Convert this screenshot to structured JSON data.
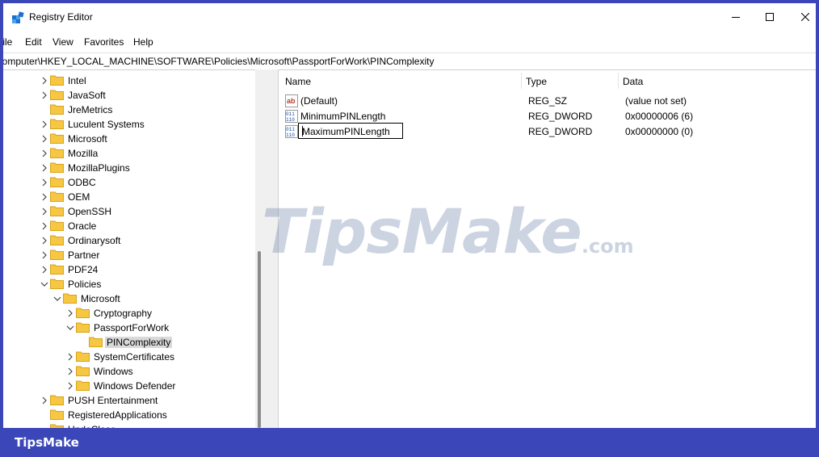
{
  "window": {
    "title": "Registry Editor"
  },
  "menu": [
    "File",
    "Edit",
    "View",
    "Favorites",
    "Help"
  ],
  "address": "Computer\\HKEY_LOCAL_MACHINE\\SOFTWARE\\Policies\\Microsoft\\PassportForWork\\PINComplexity",
  "tree": [
    {
      "label": "Intel",
      "depth": 0,
      "expander": "collapsed"
    },
    {
      "label": "JavaSoft",
      "depth": 0,
      "expander": "collapsed"
    },
    {
      "label": "JreMetrics",
      "depth": 0,
      "expander": "none"
    },
    {
      "label": "Luculent Systems",
      "depth": 0,
      "expander": "collapsed"
    },
    {
      "label": "Microsoft",
      "depth": 0,
      "expander": "collapsed"
    },
    {
      "label": "Mozilla",
      "depth": 0,
      "expander": "collapsed"
    },
    {
      "label": "MozillaPlugins",
      "depth": 0,
      "expander": "collapsed"
    },
    {
      "label": "ODBC",
      "depth": 0,
      "expander": "collapsed"
    },
    {
      "label": "OEM",
      "depth": 0,
      "expander": "collapsed"
    },
    {
      "label": "OpenSSH",
      "depth": 0,
      "expander": "collapsed"
    },
    {
      "label": "Oracle",
      "depth": 0,
      "expander": "collapsed"
    },
    {
      "label": "Ordinarysoft",
      "depth": 0,
      "expander": "collapsed"
    },
    {
      "label": "Partner",
      "depth": 0,
      "expander": "collapsed"
    },
    {
      "label": "PDF24",
      "depth": 0,
      "expander": "collapsed"
    },
    {
      "label": "Policies",
      "depth": 0,
      "expander": "expanded"
    },
    {
      "label": "Microsoft",
      "depth": 1,
      "expander": "expanded"
    },
    {
      "label": "Cryptography",
      "depth": 2,
      "expander": "collapsed"
    },
    {
      "label": "PassportForWork",
      "depth": 2,
      "expander": "expanded"
    },
    {
      "label": "PINComplexity",
      "depth": 3,
      "expander": "none",
      "selected": true
    },
    {
      "label": "SystemCertificates",
      "depth": 2,
      "expander": "collapsed"
    },
    {
      "label": "Windows",
      "depth": 2,
      "expander": "collapsed"
    },
    {
      "label": "Windows Defender",
      "depth": 2,
      "expander": "collapsed"
    },
    {
      "label": "PUSH Entertainment",
      "depth": 0,
      "expander": "collapsed"
    },
    {
      "label": "RegisteredApplications",
      "depth": 0,
      "expander": "none"
    },
    {
      "label": "UndoClose",
      "depth": 0,
      "expander": "none"
    }
  ],
  "columns": {
    "name": "Name",
    "type": "Type",
    "data": "Data"
  },
  "values": [
    {
      "icon": "string-value-icon",
      "name": "(Default)",
      "type": "REG_SZ",
      "data": "(value not set)",
      "renaming": false
    },
    {
      "icon": "dword-value-icon",
      "name": "MinimumPINLength",
      "type": "REG_DWORD",
      "data": "0x00000006 (6)",
      "renaming": false
    },
    {
      "icon": "dword-value-icon",
      "name": "MaximumPINLength",
      "type": "REG_DWORD",
      "data": "0x00000000 (0)",
      "renaming": true
    }
  ],
  "watermark": {
    "text": "TipsMake",
    "suffix": ".com"
  },
  "footer_brand": "TipsMake",
  "colors": {
    "frame": "#3b47b9",
    "folder": "#f5c742",
    "selection": "#d9d9d9"
  }
}
